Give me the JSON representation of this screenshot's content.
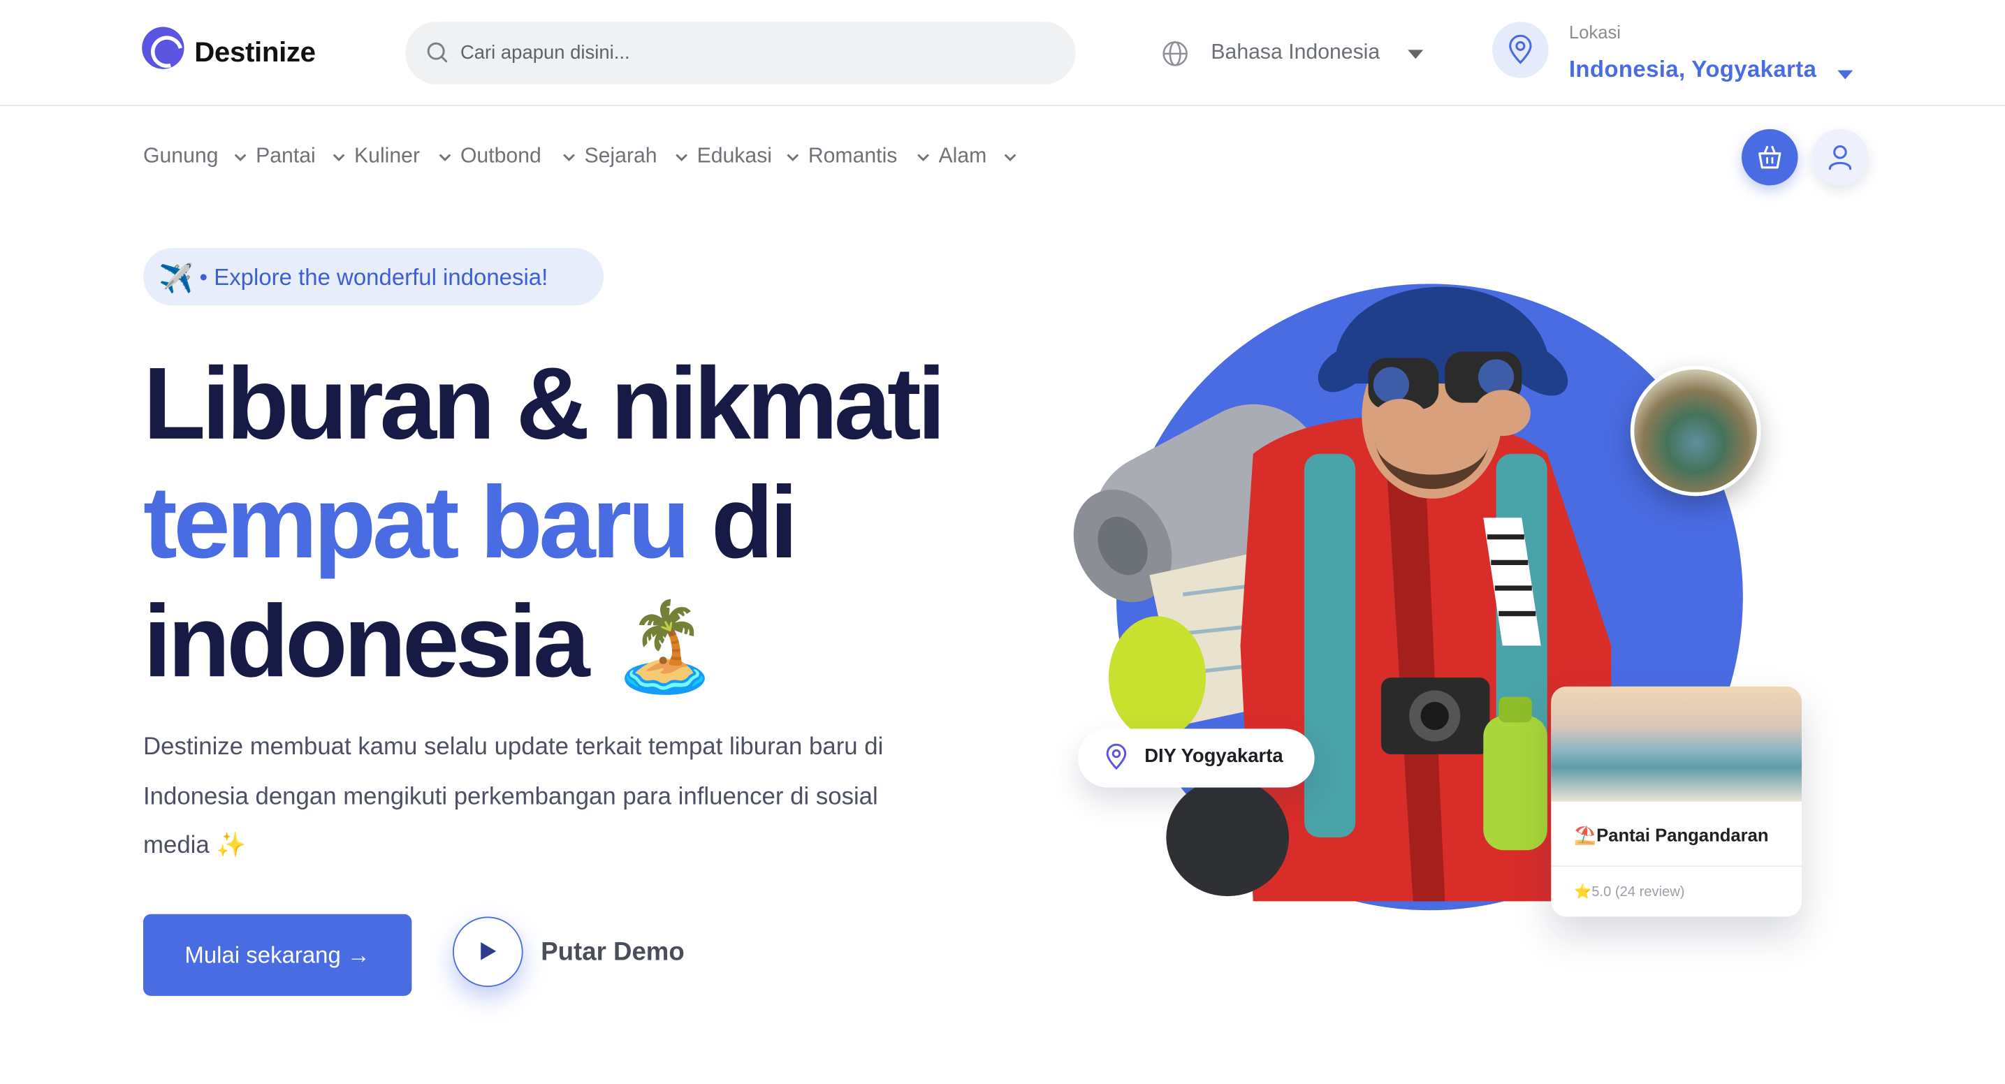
{
  "header": {
    "brand": "Destinize",
    "search_placeholder": "Cari apapun disini...",
    "language": "Bahasa Indonesia",
    "location_label": "Lokasi",
    "location_value": "Indonesia, Yogyakarta"
  },
  "categories": [
    "Gunung",
    "Pantai",
    "Kuliner",
    "Outbond",
    "Sejarah",
    "Edukasi",
    "Romantis",
    "Alam"
  ],
  "hero": {
    "tagline_icon": "✈️",
    "tagline": "• Explore the wonderful indonesia!",
    "title_line1": "Liburan & nikmati",
    "title_line2_highlight": "tempat baru",
    "title_line2_rest": " di",
    "title_line3": "indonesia",
    "title_emoji": "🏝️",
    "description": "Destinize membuat kamu selalu update terkait tempat liburan baru di Indonesia dengan mengikuti perkembangan para influencer di sosial media ✨",
    "cta_label": "Mulai sekarang →",
    "demo_label": "Putar Demo"
  },
  "visual": {
    "location_chip": "DIY Yogyakarta",
    "card_title_icon": "⛱️",
    "card_title": "Pantai Pangandaran",
    "card_rating": "⭐5.0 (24 review)"
  },
  "colors": {
    "accent": "#4a6ce3",
    "heading": "#171a44",
    "brand_mark": "#5b54e0"
  },
  "icons": [
    "search-icon",
    "globe-icon",
    "chevron-down-icon",
    "location-pin-icon",
    "basket-icon",
    "user-icon",
    "play-icon"
  ]
}
